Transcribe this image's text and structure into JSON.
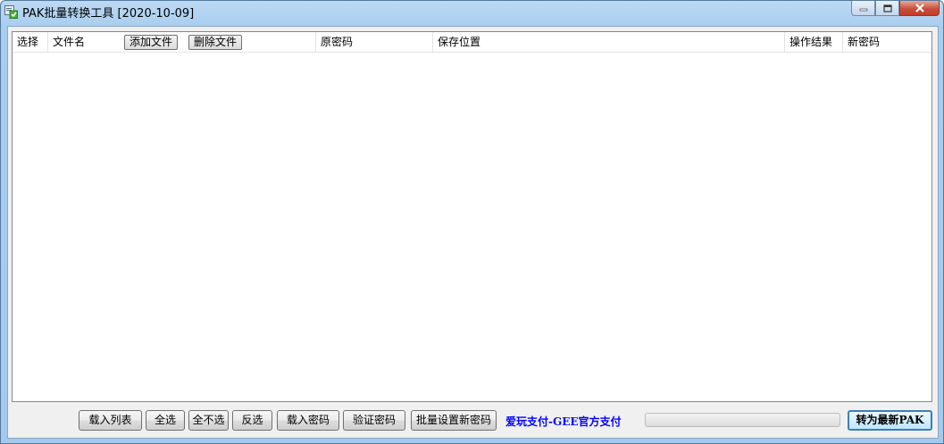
{
  "window": {
    "title": "PAK批量转换工具 [2020-10-09]"
  },
  "list": {
    "columns": {
      "select": "选择",
      "filename": "文件名",
      "old_password": "原密码",
      "save_location": "保存位置",
      "result": "操作结果",
      "new_password": "新密码"
    },
    "add_file_label": "添加文件",
    "delete_file_label": "删除文件",
    "rows": []
  },
  "toolbar": {
    "load_list": "载入列表",
    "select_all": "全选",
    "select_none": "全不选",
    "invert": "反选",
    "load_password": "载入密码",
    "verify_password": "验证密码",
    "batch_set_password": "批量设置新密码",
    "pay_link": "爱玩支付-GEE官方支付",
    "progress": 0,
    "convert": "转为最新PAK"
  },
  "colors": {
    "link": "#0000ff",
    "close_button": "#c7503b",
    "default_button_border": "#3c7fb1"
  },
  "icons": [
    "app-icon",
    "minimize-icon",
    "maximize-icon",
    "close-icon"
  ]
}
